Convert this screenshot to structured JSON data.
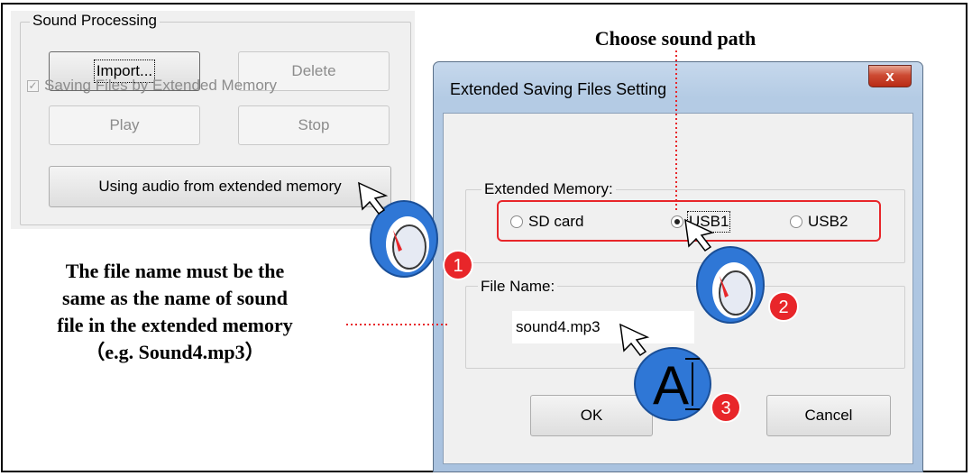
{
  "sound_processing": {
    "title": "Sound Processing",
    "import_label": "Import...",
    "delete_label": "Delete",
    "play_label": "Play",
    "stop_label": "Stop",
    "extended_audio_label": "Using audio from extended memory"
  },
  "dialog": {
    "title": "Extended Saving Files Setting",
    "close_glyph": "x",
    "saving_checkbox_label": "Saving Files by Extended Memory",
    "extended_memory_group": "Extended Memory:",
    "options": [
      "SD card",
      "USB1",
      "USB2"
    ],
    "selected_option": "USB1",
    "file_name_group": "File Name:",
    "file_name_value": "sound4.mp3",
    "ok_label": "OK",
    "cancel_label": "Cancel"
  },
  "annotations": {
    "choose_path": "Choose sound path",
    "file_name_note_lines": [
      "The file name must be the",
      "same as the name of sound",
      "file in the extended memory",
      "（e.g. Sound4.mp3）"
    ],
    "step_badges": [
      "1",
      "2",
      "3"
    ],
    "text_cursor_glyph": "A"
  },
  "colors": {
    "accent_red": "#e8262a",
    "mouse_blue": "#2f77d6",
    "dialog_frame": "#a9c2df"
  },
  "icons": [
    "mouse-click-icon",
    "text-input-icon",
    "pointer-arrow-icon"
  ]
}
